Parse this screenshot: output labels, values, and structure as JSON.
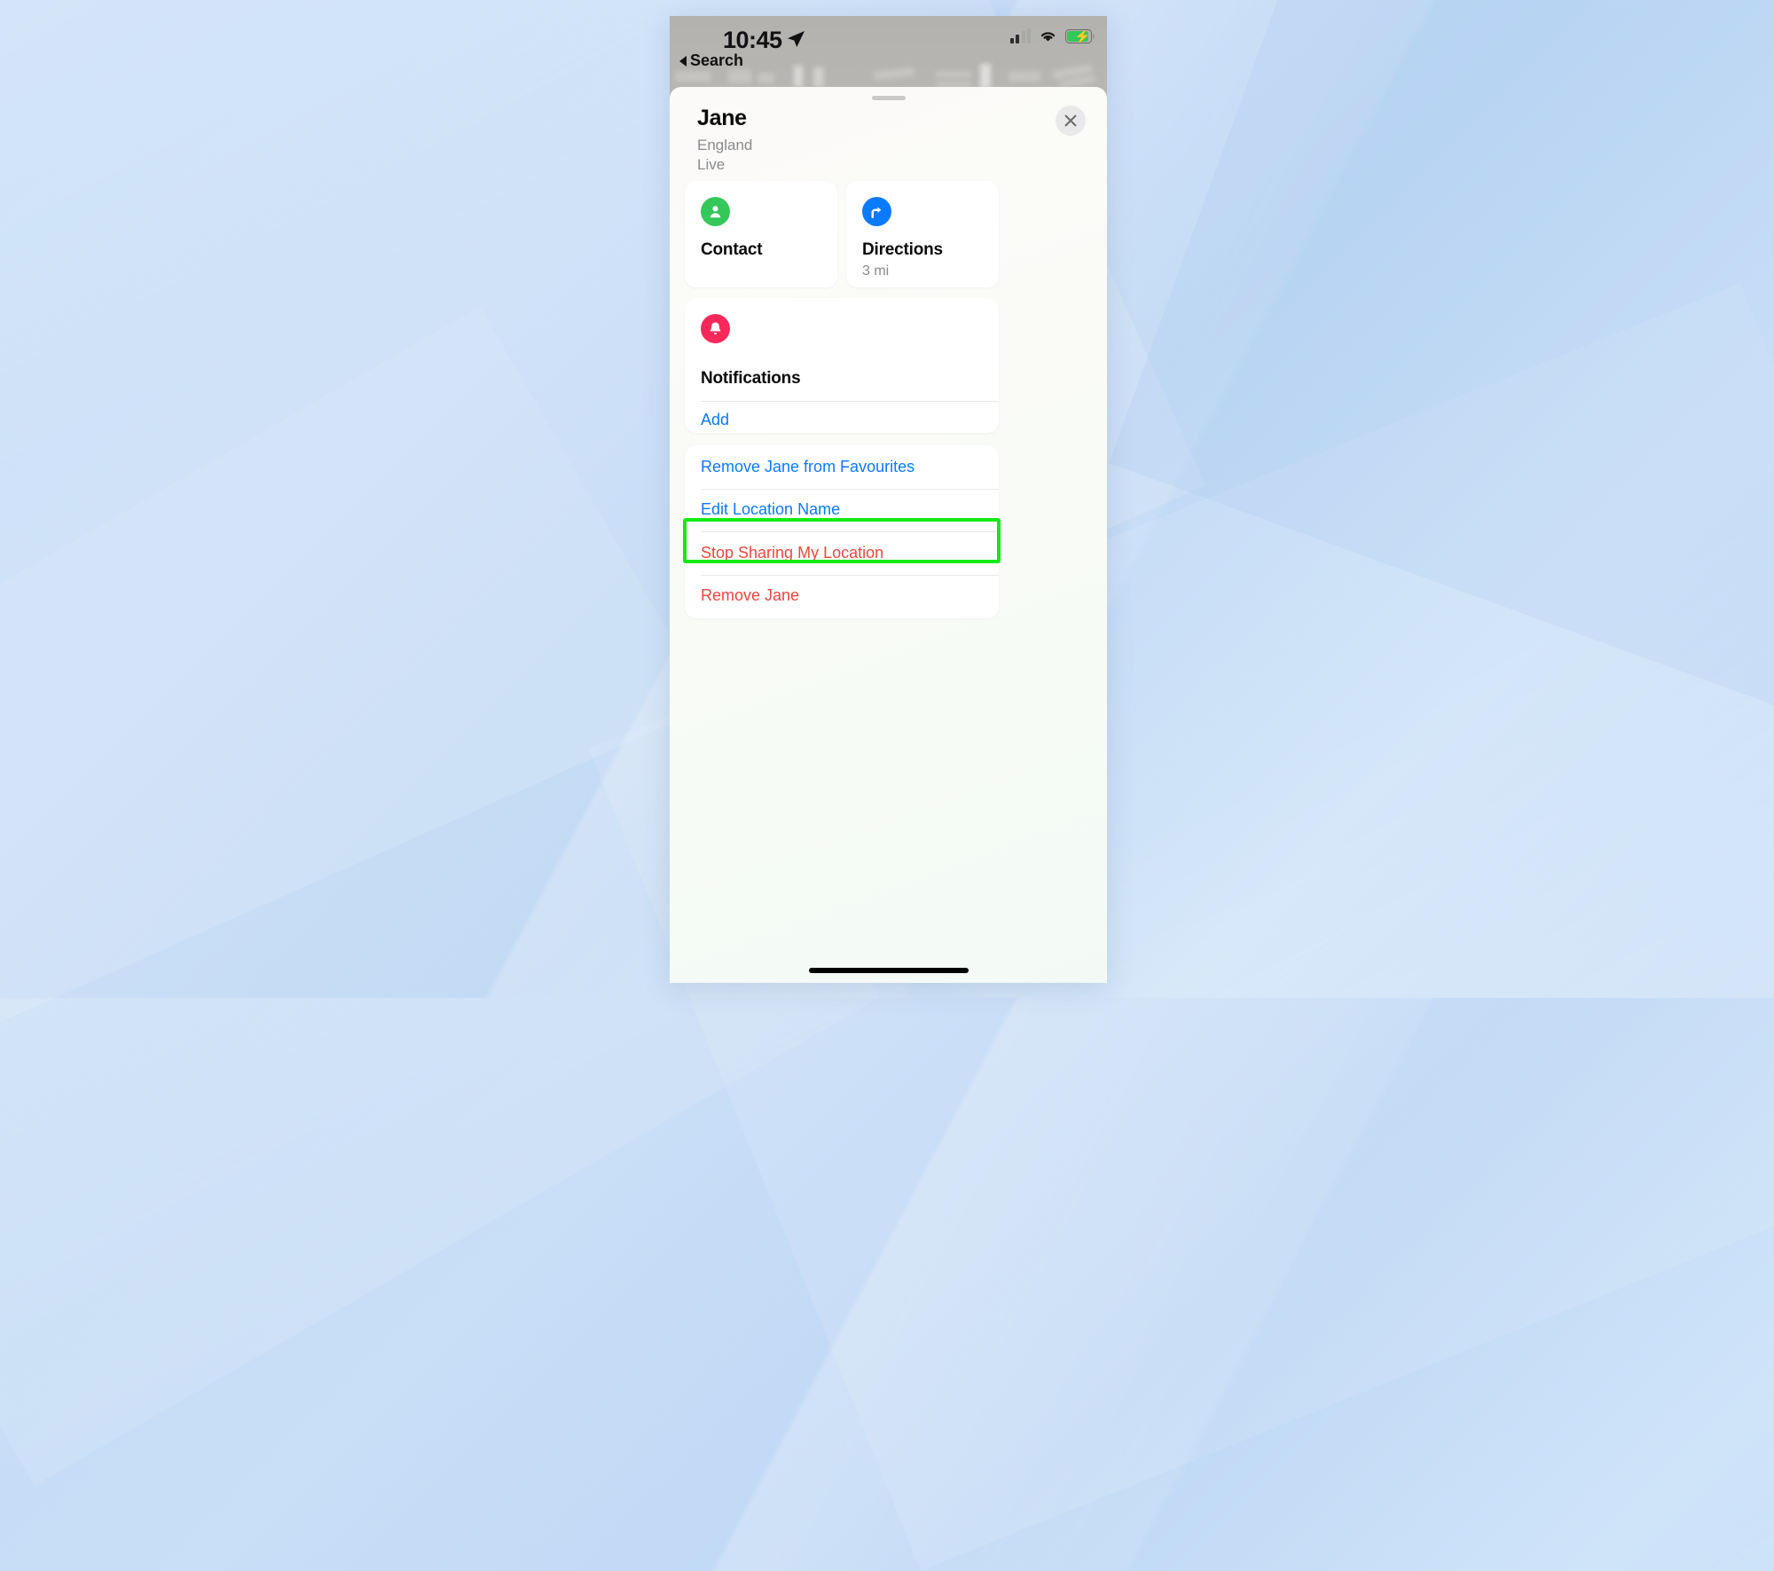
{
  "status_bar": {
    "time": "10:45",
    "location_arrow_icon": "location-arrow-icon",
    "back_label": "Search",
    "signal_icon": "cellular-signal-icon",
    "wifi_icon": "wifi-icon",
    "battery_icon": "battery-charging-icon"
  },
  "sheet": {
    "grabber": "sheet-grabber",
    "title": "Jane",
    "subtitle_region": "England",
    "subtitle_status": "Live",
    "close_icon": "close-icon"
  },
  "cards": {
    "contact": {
      "icon": "person-circle-icon",
      "title": "Contact",
      "icon_color": "#34c759"
    },
    "directions": {
      "icon": "turn-right-arrow-icon",
      "title": "Directions",
      "subtitle": "3 mi",
      "icon_color": "#0a7aff"
    },
    "notifications": {
      "icon": "bell-icon",
      "title": "Notifications",
      "add_label": "Add",
      "icon_color": "#f8285a"
    }
  },
  "actions": [
    {
      "label": "Remove Jane from Favourites",
      "style": "blue"
    },
    {
      "label": "Edit Location Name",
      "style": "blue"
    },
    {
      "label": "Stop Sharing My Location",
      "style": "red"
    },
    {
      "label": "Remove Jane",
      "style": "red"
    }
  ],
  "annotation": {
    "highlight_color": "#13eb13",
    "highlighted_action": "Stop Sharing My Location"
  },
  "colors": {
    "link_blue": "#0a7aff",
    "destructive_red": "#f3453c",
    "green": "#34c759",
    "pink": "#f8285a",
    "background_blue": "#c3dcf6"
  }
}
